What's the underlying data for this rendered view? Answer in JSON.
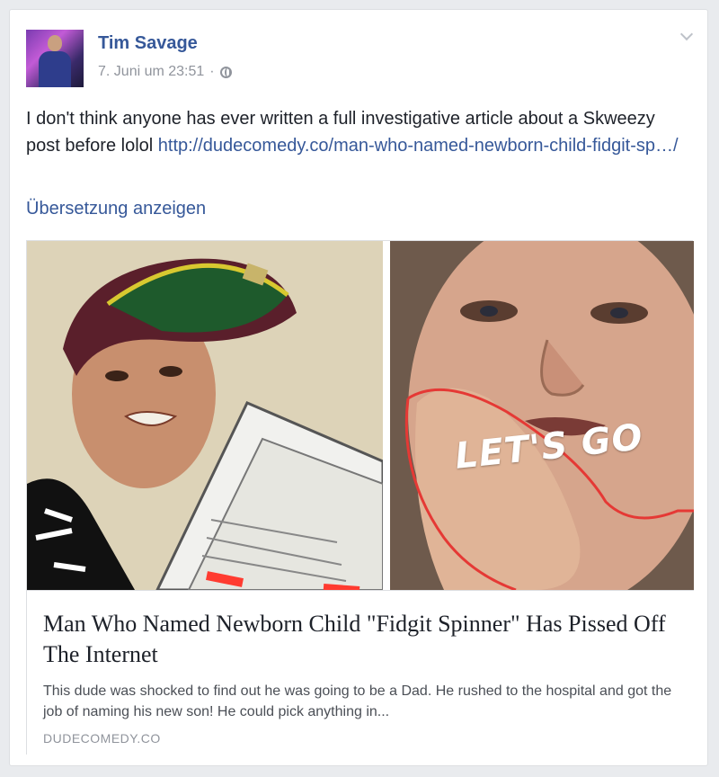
{
  "post": {
    "author": "Tim Savage",
    "timestamp": "7. Juni um 23:51",
    "separator": "·",
    "privacy_icon": "globe-icon",
    "menu_icon": "chevron-down-icon",
    "text": "I don't think anyone has ever written a full investigative article about a Skweezy post before lolol ",
    "link": "http://dudecomedy.co/man-who-named-newborn-child-fidgit-sp…/",
    "translate": "Übersetzung anzeigen"
  },
  "link_card": {
    "image_overlay_text": "LET'S GO",
    "title": "Man Who Named Newborn Child \"Fidgit Spinner\" Has Pissed Off The Internet",
    "description": "This dude was shocked to find out he was going to be a Dad. He rushed to the hospital and got the job of naming his new son! He could pick anything in...",
    "domain": "DUDECOMEDY.CO"
  },
  "colors": {
    "link": "#365899",
    "text": "#1d2129",
    "meta": "#90949c",
    "highlight_stroke": "#e53935"
  }
}
